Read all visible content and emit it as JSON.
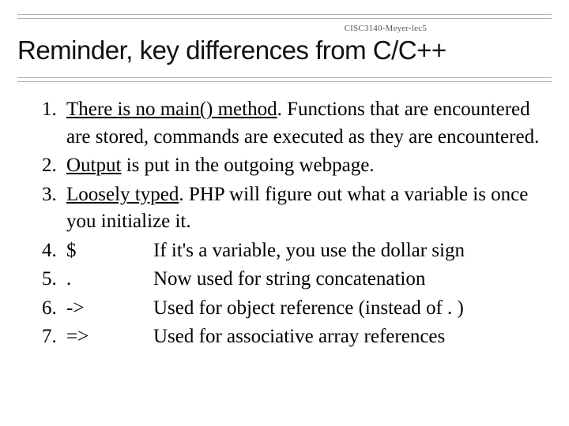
{
  "course_tag": "CISC3140-Meyer-lec5",
  "title": "Reminder, key differences from C/C++",
  "items": [
    {
      "lead_u": "There is no main() method",
      "lead_rest": ". Functions that are encountered are stored, commands are executed as they are encountered."
    },
    {
      "lead_u": "Output",
      "lead_rest": " is put in the outgoing webpage."
    },
    {
      "lead_u": "Loosely typed",
      "lead_rest": ". PHP will figure out what a variable is once you initialize it."
    },
    {
      "symbol": "$",
      "desc": "If it's a variable, you use the dollar sign"
    },
    {
      "symbol": ".",
      "desc": "Now used for string concatenation"
    },
    {
      "symbol": "->",
      "desc": "Used for object reference (instead of . )"
    },
    {
      "symbol": "=>",
      "desc": "Used for associative array references"
    }
  ]
}
